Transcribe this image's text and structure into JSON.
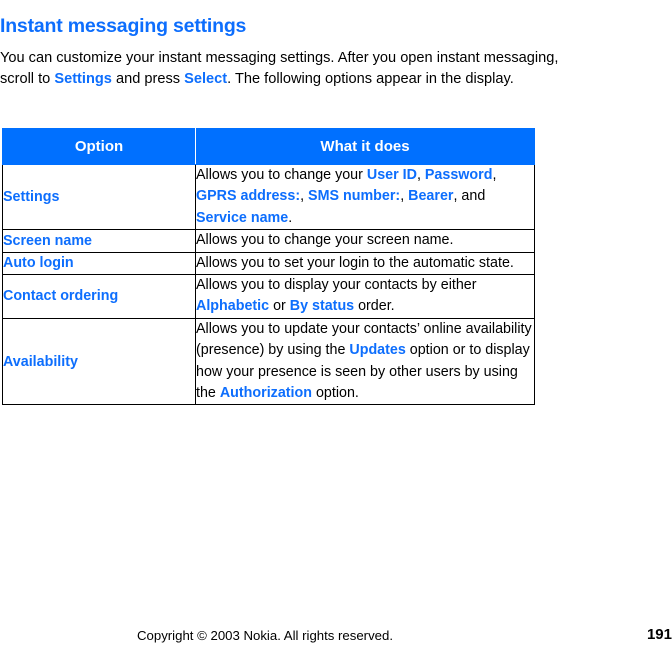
{
  "document": {
    "title": "Instant messaging settings",
    "intro": {
      "part1": "You can customize your instant messaging settings. After you open instant messaging, scroll to ",
      "term1": "Settings",
      "part2": " and press ",
      "term2": "Select",
      "part3": ". The following options appear in the display."
    }
  },
  "table": {
    "headers": {
      "option": "Option",
      "what_it_does": "What it does"
    },
    "rows": [
      {
        "option": "Settings",
        "desc": {
          "p1": "Allows you to change your ",
          "t1": "User ID",
          "p2": ", ",
          "t2": "Password",
          "p3": ", ",
          "t3": "GPRS address:",
          "p4": ", ",
          "t4": "SMS number:",
          "p5": ", ",
          "t5": "Bearer",
          "p6": ", and ",
          "t6": "Service name",
          "p7": "."
        }
      },
      {
        "option": "Screen name",
        "desc": {
          "p1": "Allows you to change your screen name."
        }
      },
      {
        "option": "Auto login",
        "desc": {
          "p1": "Allows you to set your login to the automatic state."
        }
      },
      {
        "option": "Contact ordering",
        "desc": {
          "p1": "Allows you to display your contacts by either ",
          "t1": "Alphabetic",
          "p2": " or ",
          "t2": "By status",
          "p3": " order."
        }
      },
      {
        "option": "Availability",
        "desc": {
          "p1": "Allows you to update your contacts’ online availability (presence) by using the ",
          "t1": "Updates",
          "p2": " option or to display how your presence is seen by other users by using the ",
          "t2": "Authorization",
          "p3": " option."
        }
      }
    ]
  },
  "footer": {
    "copyright": "Copyright © 2003 Nokia. All rights reserved.",
    "page_number": "191"
  },
  "colors": {
    "accent_blue": "#0d6efd",
    "header_blue": "#0070ff",
    "text_black": "#000000",
    "background": "#ffffff"
  }
}
